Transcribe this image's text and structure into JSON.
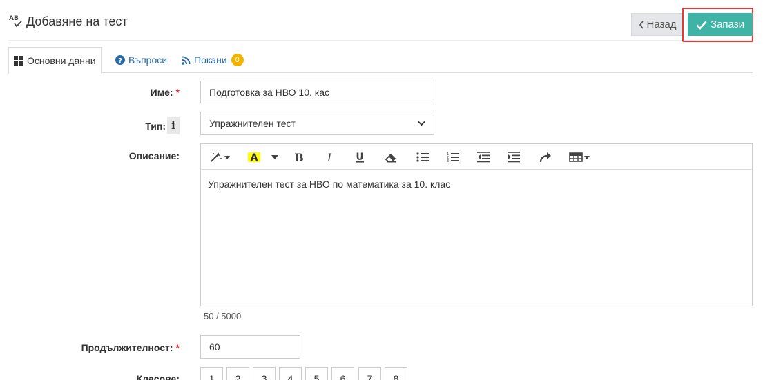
{
  "header": {
    "title": "Добавяне на тест",
    "back_label": "Назад",
    "save_label": "Запази"
  },
  "tabs": [
    {
      "label": "Основни данни",
      "active": true
    },
    {
      "label": "Въпроси",
      "active": false
    },
    {
      "label": "Покани",
      "active": false,
      "badge": "0"
    }
  ],
  "form": {
    "name": {
      "label": "Име:",
      "required": true,
      "value": "Подготовка за НВО 10. кас"
    },
    "type": {
      "label": "Тип:",
      "value": "Упражнителен тест"
    },
    "description": {
      "label": "Описание:",
      "value": "Упражнителен тест за НВО по математика за 10. клас",
      "counter": "50 / 5000"
    },
    "duration": {
      "label": "Продължителност:",
      "required": true,
      "value": "60"
    },
    "grades": {
      "label": "Класове:",
      "options": [
        "1",
        "2",
        "3",
        "4",
        "5",
        "6",
        "7",
        "8"
      ]
    }
  },
  "colors": {
    "save_button": "#3fb4a6",
    "highlight": "#e53935",
    "badge": "#f0b400",
    "link": "#2a6aa6"
  }
}
